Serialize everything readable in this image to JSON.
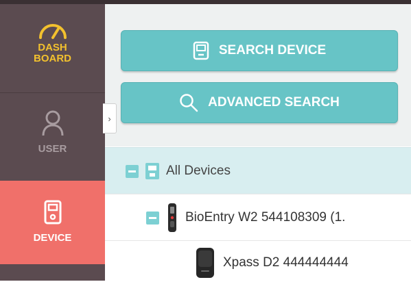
{
  "sidebar": {
    "items": [
      {
        "label": "DASH\nBOARD",
        "icon": "gauge-icon",
        "color": "#f2c12e"
      },
      {
        "label": "USER",
        "icon": "user-icon",
        "color": "#a89ca0"
      },
      {
        "label": "DEVICE",
        "icon": "device-icon",
        "color": "#ffffff",
        "active": true
      }
    ],
    "active_color": "#f0706a"
  },
  "toolbar": {
    "search_label": "SEARCH DEVICE",
    "advanced_label": "ADVANCED SEARCH",
    "accent": "#67c4c6"
  },
  "collapse_icon": "chevron-right-icon",
  "tree": {
    "root": {
      "label": "All Devices"
    },
    "children": [
      {
        "label": "BioEntry W2 544108309 (1.",
        "icon": "bioentry-device-icon"
      },
      {
        "label": "Xpass D2 444444444",
        "icon": "xpass-device-icon"
      }
    ]
  }
}
